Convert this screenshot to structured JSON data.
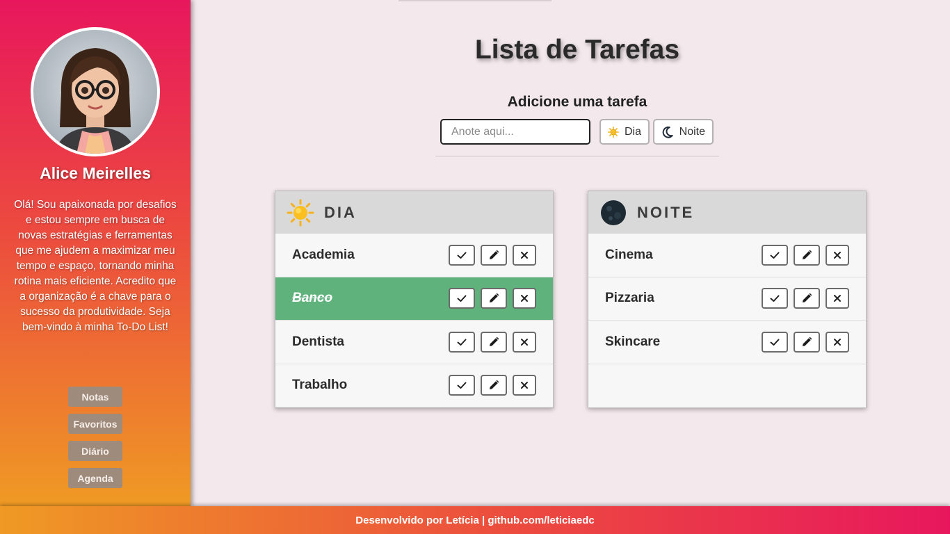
{
  "profile": {
    "name": "Alice Meirelles",
    "bio": "Olá! Sou apaixonada por desafios e estou sempre em busca de novas estratégias e ferramentas que me ajudem a maximizar meu tempo e espaço, tornando minha rotina mais eficiente. Acredito que a organização é a chave para o sucesso da produtividade. Seja bem-vindo à minha To-Do List!"
  },
  "nav": [
    "Notas",
    "Favoritos",
    "Diário",
    "Agenda"
  ],
  "header": {
    "title": "Lista de Tarefas",
    "add_label": "Adicione uma tarefa",
    "input_placeholder": "Anote aqui...",
    "btn_day": "Dia",
    "btn_night": "Noite"
  },
  "lists": {
    "day": {
      "title": "DIA",
      "icon": "sun-icon",
      "tasks": [
        {
          "text": "Academia",
          "done": false
        },
        {
          "text": "Banco",
          "done": true
        },
        {
          "text": "Dentista",
          "done": false
        },
        {
          "text": "Trabalho",
          "done": false
        }
      ]
    },
    "night": {
      "title": "NOITE",
      "icon": "moon-icon",
      "tasks": [
        {
          "text": "Cinema",
          "done": false
        },
        {
          "text": "Pizzaria",
          "done": false
        },
        {
          "text": "Skincare",
          "done": false
        }
      ]
    }
  },
  "footer": {
    "text": "Desenvolvido por Letícia | github.com/leticiaedc"
  },
  "colors": {
    "done_row": "#5fb27b",
    "nav_button": "#9e8b7c",
    "gradient_pink": "#e8175d",
    "gradient_orange": "#ef9a24"
  }
}
